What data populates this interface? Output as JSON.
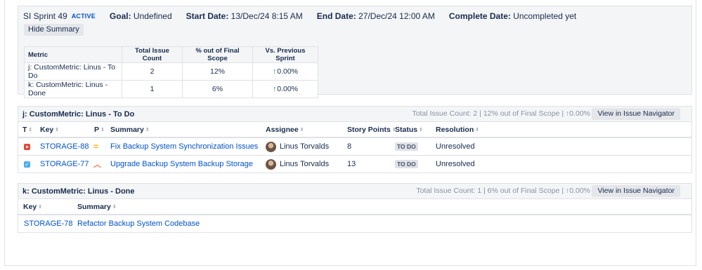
{
  "sprint": {
    "name": "SI Sprint 49",
    "state": "ACTIVE",
    "goal_label": "Goal:",
    "goal_value": "Undefined",
    "start_label": "Start Date:",
    "start_value": "13/Dec/24 8:15 AM",
    "end_label": "End Date:",
    "end_value": "27/Dec/24 12:00 AM",
    "complete_label": "Complete Date:",
    "complete_value": "Uncompleted yet",
    "hide_summary_label": "Hide Summary"
  },
  "metrics_table": {
    "headers": [
      "Metric",
      "Total Issue Count",
      "% out of Final Scope",
      "Vs. Previous Sprint"
    ],
    "rows": [
      {
        "metric": "j: CustomMetric: Linus - To Do",
        "count": "2",
        "percent": "12%",
        "vs_prev": "0.00%"
      },
      {
        "metric": "k: CustomMetric: Linus - Done",
        "count": "1",
        "percent": "6%",
        "vs_prev": "0.00%"
      }
    ]
  },
  "section_todo": {
    "title": "j: CustomMetric: Linus - To Do",
    "stats": "Total Issue Count: 2 | 12% out of Final Scope | ",
    "stats_delta": "0.00%",
    "nav_button": "View in Issue Navigator",
    "columns": {
      "t": "T",
      "key": "Key",
      "p": "P",
      "summary": "Summary",
      "assignee": "Assignee",
      "points": "Story Points",
      "status": "Status",
      "resolution": "Resolution"
    },
    "rows": [
      {
        "type_icon": "bug-icon",
        "key": "STORAGE-88",
        "priority_icon": "medium-priority-icon",
        "summary": "Fix Backup System Synchronization Issues",
        "assignee": "Linus Torvalds",
        "points": "8",
        "status": "TO DO",
        "resolution": "Unresolved"
      },
      {
        "type_icon": "task-icon",
        "key": "STORAGE-77",
        "priority_icon": "high-priority-icon",
        "summary": "Upgrade Backup System Backup Storage",
        "assignee": "Linus Torvalds",
        "points": "13",
        "status": "TO DO",
        "resolution": "Unresolved"
      }
    ]
  },
  "section_done": {
    "title": "k: CustomMetric: Linus - Done",
    "stats": "Total Issue Count: 1 | 6% out of Final Scope | ",
    "stats_delta": "0.00%",
    "nav_button": "View in Issue Navigator",
    "columns": {
      "key": "Key",
      "summary": "Summary"
    },
    "rows": [
      {
        "key": "STORAGE-78",
        "summary": "Refactor Backup System Codebase"
      }
    ]
  },
  "colors": {
    "link": "#0052cc",
    "active": "#0052cc",
    "positive": "#00875a",
    "bug": "#e5493a",
    "task": "#4bade8",
    "priority_medium": "#ffab00",
    "priority_high": "#ff7452"
  }
}
